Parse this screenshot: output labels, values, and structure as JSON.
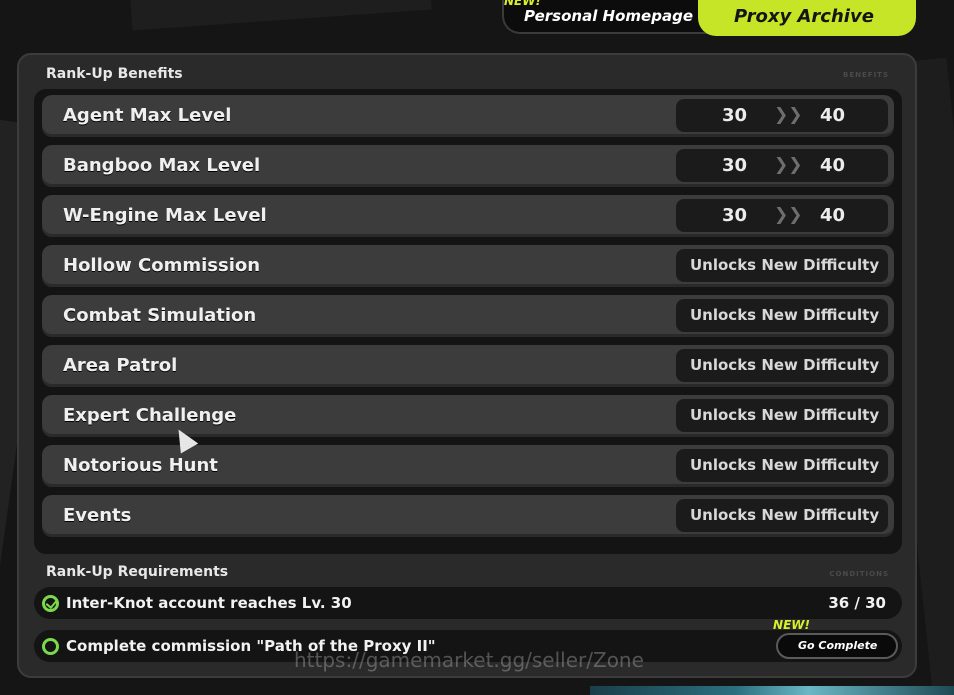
{
  "tabs": {
    "home_new_badge": "NEW!",
    "home_label": "Personal Homepage",
    "archive_label": "Proxy Archive",
    "colors": {
      "active": "#c6e526",
      "new_badge": "#d9f02b"
    }
  },
  "benefits": {
    "title": "Rank-Up Benefits",
    "tag": "BENEFITS",
    "level_rows": [
      {
        "label": "Agent Max Level",
        "from": "30",
        "to": "40"
      },
      {
        "label": "Bangboo Max Level",
        "from": "30",
        "to": "40"
      },
      {
        "label": "W-Engine Max Level",
        "from": "30",
        "to": "40"
      }
    ],
    "unlock_rows": [
      {
        "label": "Hollow Commission",
        "value": "Unlocks New Difficulty"
      },
      {
        "label": "Combat Simulation",
        "value": "Unlocks New Difficulty"
      },
      {
        "label": "Area Patrol",
        "value": "Unlocks New Difficulty"
      },
      {
        "label": "Expert Challenge",
        "value": "Unlocks New Difficulty"
      },
      {
        "label": "Notorious Hunt",
        "value": "Unlocks New Difficulty"
      },
      {
        "label": "Events",
        "value": "Unlocks New Difficulty"
      }
    ],
    "arrow_glyph": "❯❯"
  },
  "requirements": {
    "title": "Rank-Up Requirements",
    "tag": "CONDITIONS",
    "items": [
      {
        "label": "Inter-Knot account reaches Lv. 30",
        "progress": "36 / 30",
        "done": true
      },
      {
        "label": "Complete commission \"Path of the Proxy II\"",
        "done": false,
        "button_new": "NEW!",
        "button_label": "Go Complete"
      }
    ],
    "check_color": "#7bd94b"
  },
  "watermark": "https://gamemarket.gg/seller/Zone"
}
